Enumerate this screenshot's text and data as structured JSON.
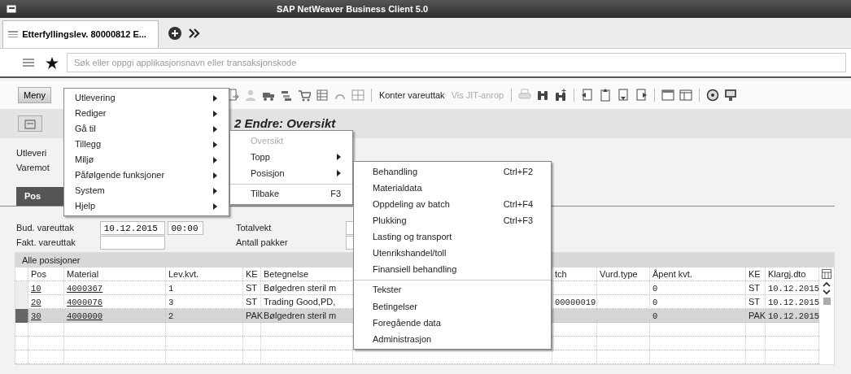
{
  "window": {
    "title": "SAP NetWeaver Business Client 5.0"
  },
  "tabs": [
    {
      "label": "Etterfyllingslev. 80000812 E...",
      "selected": true
    }
  ],
  "search": {
    "placeholder": "Søk eller oppgi applikasjonsnavn eller transaksjonskode"
  },
  "toolbar": {
    "menu_button": "Meny",
    "buttons": [
      {
        "label": "Konter vareuttak",
        "disabled": false
      },
      {
        "label": "Vis JIT-anrop",
        "disabled": true
      }
    ]
  },
  "page_title": "2 Endre: Oversikt",
  "header_labels": [
    "Utleveri",
    "Varemot"
  ],
  "detail_tabs": [
    {
      "label": "Pos",
      "selected": true
    }
  ],
  "fields": [
    {
      "label": "Bud. vareuttak",
      "value": "10.12.2015",
      "time": "00:00"
    },
    {
      "label": "Fakt. vareuttak"
    }
  ],
  "totals": [
    {
      "label": "Totalvekt"
    },
    {
      "label": "Antall pakker"
    }
  ],
  "table": {
    "title": "Alle posisjoner",
    "columns": [
      "Pos",
      "Material",
      "Lev.kvt.",
      "KE",
      "Betegnelse",
      "tch",
      "Vurd.type",
      "Åpent kvt.",
      "KE",
      "Klargj.dto"
    ],
    "rows": [
      {
        "selected": false,
        "cells": [
          "10",
          "4000367",
          "1",
          "ST",
          "Bølgedren steril m",
          null,
          null,
          "0",
          "ST",
          "10.12.2015"
        ]
      },
      {
        "selected": false,
        "cells": [
          "20",
          "4000076",
          "3",
          "ST",
          "Trading Good,PD,",
          "00000019",
          null,
          "0",
          "ST",
          "10.12.2015"
        ]
      },
      {
        "selected": true,
        "cells": [
          "30",
          "4000000",
          "2",
          "PAK",
          "Bølgedren steril m",
          null,
          null,
          "0",
          "PAK",
          "10.12.2015"
        ]
      }
    ]
  },
  "menus": [
    {
      "items": [
        {
          "label": "Utlevering",
          "submenu": true
        },
        {
          "label": "Rediger",
          "submenu": true
        },
        {
          "label": "Gå til",
          "submenu": true
        },
        {
          "label": "Tillegg",
          "submenu": true
        },
        {
          "label": "Miljø",
          "submenu": true
        },
        {
          "label": "Påfølgende funksjoner",
          "submenu": true
        },
        {
          "label": "System",
          "submenu": true
        },
        {
          "label": "Hjelp",
          "submenu": true
        }
      ]
    },
    {
      "items": [
        {
          "label": "Oversikt",
          "submenu": false,
          "disabled": true,
          "separator_before": false
        },
        {
          "label": "Topp",
          "submenu": true,
          "disabled": false,
          "separator_before": false
        },
        {
          "label": "Posisjon",
          "submenu": true,
          "disabled": false,
          "separator_before": false
        },
        {
          "label": "Tilbake",
          "shortcut": "F3",
          "submenu": false,
          "disabled": false,
          "separator_before": true
        }
      ]
    },
    {
      "items": [
        {
          "label": "Behandling",
          "shortcut": "Ctrl+F2",
          "submenu": false,
          "separator_before": false
        },
        {
          "label": "Materialdata",
          "submenu": false,
          "separator_before": false
        },
        {
          "label": "Oppdeling av batch",
          "shortcut": "Ctrl+F4",
          "submenu": false,
          "separator_before": false
        },
        {
          "label": "Plukking",
          "shortcut": "Ctrl+F3",
          "submenu": false,
          "separator_before": false
        },
        {
          "label": "Lasting og transport",
          "submenu": false,
          "separator_before": false
        },
        {
          "label": "Utenrikshandel/toll",
          "submenu": false,
          "separator_before": false
        },
        {
          "label": "Finansiell behandling",
          "submenu": false,
          "separator_before": false
        },
        {
          "label": "Tekster",
          "submenu": false,
          "separator_before": true
        },
        {
          "label": "Betingelser",
          "submenu": false,
          "separator_before": false
        },
        {
          "label": "Foregående data",
          "submenu": false,
          "separator_before": false
        },
        {
          "label": "Administrasjon",
          "submenu": false,
          "separator_before": false
        }
      ]
    }
  ]
}
